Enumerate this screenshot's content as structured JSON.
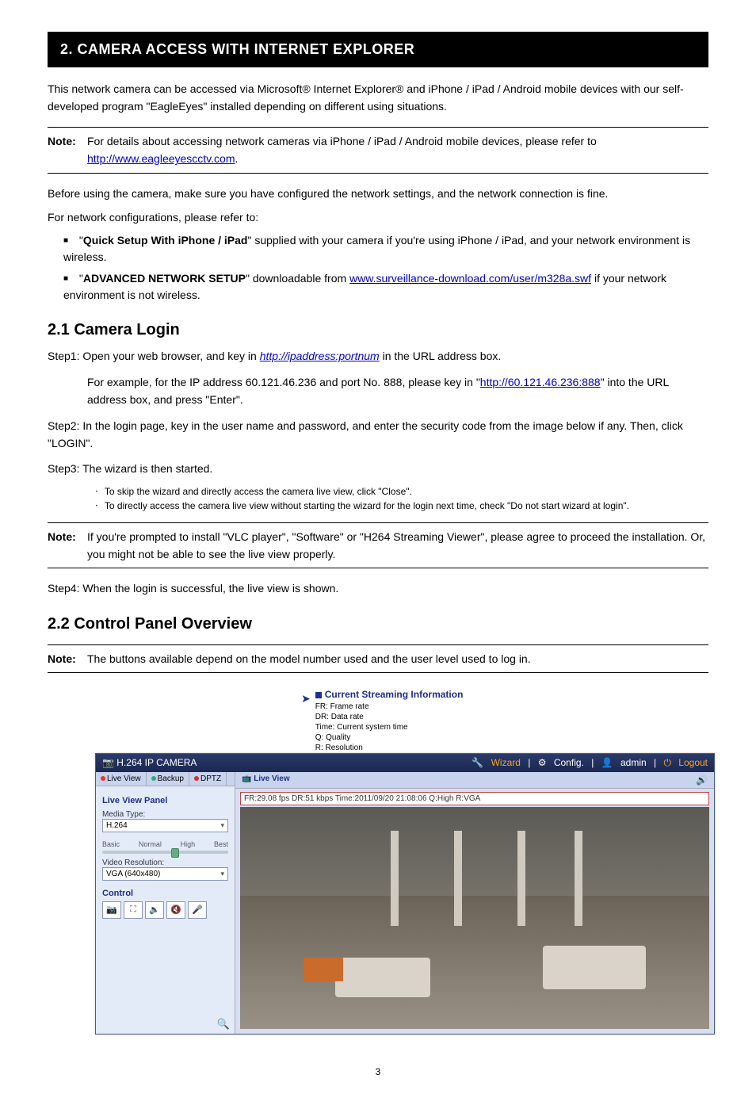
{
  "section_header": "2. CAMERA ACCESS WITH INTERNET EXPLORER",
  "intro": "This network camera can be accessed via Microsoft® Internet Explorer® and iPhone / iPad / Android mobile devices with our self-developed program \"EagleEyes\" installed depending on different using situations.",
  "note1": {
    "label": "Note:",
    "text_prefix": "For details about accessing network cameras via iPhone / iPad / Android mobile devices, please refer to ",
    "link": "http://www.eagleeyescctv.com",
    "text_suffix": "."
  },
  "before": "Before using the camera, make sure you have configured the network settings, and the network connection is fine.",
  "for_config": "For network configurations, please refer to:",
  "bullet1": {
    "strong": "Quick Setup With iPhone / iPad",
    "rest": "\" supplied with your camera if you're using iPhone / iPad, and your network environment is wireless."
  },
  "bullet2": {
    "strong": "ADVANCED NETWORK SETUP",
    "rest_pre": "\" downloadable from ",
    "link": "www.surveillance-download.com/user/m328a.swf",
    "rest_post": " if your network environment is not wireless."
  },
  "h21": "2.1 Camera Login",
  "step1": {
    "label": "Step1:",
    "text_pre": "Open your web browser, and key in ",
    "link": "http://ipaddress:portnum",
    "text_post": " in the URL address box."
  },
  "step1_example": {
    "pre": "For example, for the IP address 60.121.46.236 and port No. 888, please key in \"",
    "link": "http://60.121.46.236:888",
    "post": "\" into the URL address box, and press \"Enter\"."
  },
  "step2": "Step2: In the login page, key in the user name and password, and enter the security code from the image below if any. Then, click \"LOGIN\".",
  "step3": "Step3: The wizard is then started.",
  "step3_dots": [
    "To skip the wizard and directly access the camera live view, click \"Close\".",
    "To directly access the camera live view without starting the wizard for the login next time, check \"Do not start wizard at login\"."
  ],
  "note2": {
    "label": "Note:",
    "text": "If you're prompted to install \"VLC player\", \"Software\" or \"H264 Streaming Viewer\", please agree to proceed the installation. Or, you might not be able to see the live view properly."
  },
  "step4": "Step4: When the login is successful, the live view is shown.",
  "h22": "2.2 Control Panel Overview",
  "note3": {
    "label": "Note:",
    "text": "The buttons available depend on the model number used and the user level used to log in."
  },
  "csi": {
    "title": "Current Streaming Information",
    "lines": [
      "FR: Frame rate",
      "DR: Data rate",
      "Time: Current system time",
      "Q: Quality",
      "R: Resolution"
    ]
  },
  "ui": {
    "title": "H.264 IP CAMERA",
    "topright": {
      "wizard": "Wizard",
      "config": "Config.",
      "admin": "admin",
      "logout": "Logout"
    },
    "left_tabs": {
      "live": "Live View",
      "backup": "Backup",
      "dptz": "DPTZ"
    },
    "panel_header": "Live View Panel",
    "media_type_label": "Media Type:",
    "media_type_value": "H.264",
    "quality_labels": [
      "Basic",
      "Normal",
      "High",
      "Best"
    ],
    "vres_label": "Video Resolution:",
    "vres_value": "VGA (640x480)",
    "control_label": "Control",
    "zoom_icon": "🔍",
    "main_tab": "Live View",
    "stream_bar": "FR:29.08 fps DR:51 kbps Time:2011/09/20 21:08:06 Q:High R:VGA"
  },
  "page_number": "3"
}
